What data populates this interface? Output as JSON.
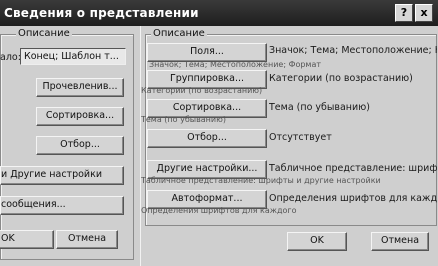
{
  "window": {
    "title": "Сведения о представлении",
    "help_glyph": "?",
    "close_glyph": "x"
  },
  "back_dialog": {
    "group_label": "Описание",
    "field_label": "ало:",
    "field_value": "Конец; Шаблон т...",
    "buttons": [
      "Прочевленив...",
      "Сортировка...",
      "Отбор...",
      "и Другие настройки",
      "сообщения..."
    ],
    "ok_label": "OK",
    "cancel_label": "Отмена"
  },
  "front_dialog": {
    "group_label": "Описание",
    "rows": [
      {
        "button": "Поля...",
        "desc": "Значок; Тема; Местоположение; Нач",
        "sub": "Значок; Тема; Местоположение; Формат"
      },
      {
        "button": "Группировка...",
        "desc": "Категории (по возрастанию)",
        "sub": "Категории (по возрастанию)"
      },
      {
        "button": "Сортировка...",
        "desc": "Тема (по убыванию)",
        "sub": "Тема (по убыванию)"
      },
      {
        "button": "Отбор...",
        "desc": "Отсутствует",
        "sub": ""
      },
      {
        "button": "Другие настройки...",
        "desc": "Табличное представление: шрифты",
        "sub": "Табличное представление: шрифты и другие настройки"
      },
      {
        "button": "Автоформат...",
        "desc": "Определения шрифтов для каждого",
        "sub": "Определения шрифтов для каждого"
      }
    ],
    "ok_label": "OK",
    "cancel_label": "Отмена"
  }
}
